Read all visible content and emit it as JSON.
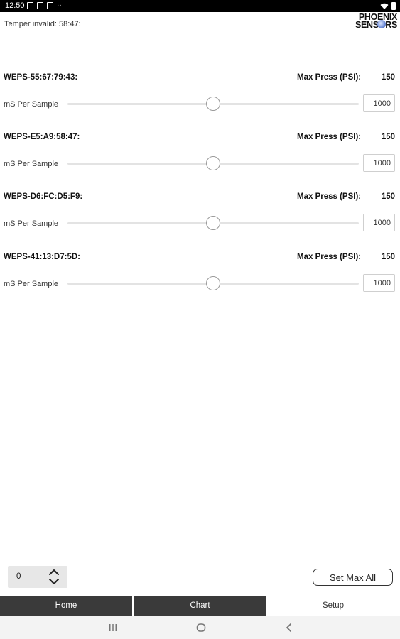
{
  "status_bar": {
    "time": "12:50",
    "left_icons": [
      "image-icon",
      "notification-icon",
      "play-icon",
      "more-dots"
    ],
    "right_icons": [
      "wifi-icon",
      "battery-icon"
    ]
  },
  "header": {
    "temper_text": "Temper invalid: 58:47:",
    "logo_line1": "PHOENIX",
    "logo_line2": "SENSORS"
  },
  "sensors": [
    {
      "id": "WEPS-55:67:79:43:",
      "max_label": "Max Press (PSI):",
      "max_value": "150",
      "sample_label": "mS Per Sample",
      "sample_value": "1000",
      "slider_fraction": 0.5
    },
    {
      "id": "WEPS-E5:A9:58:47:",
      "max_label": "Max Press (PSI):",
      "max_value": "150",
      "sample_label": "mS Per Sample",
      "sample_value": "1000",
      "slider_fraction": 0.5
    },
    {
      "id": "WEPS-D6:FC:D5:F9:",
      "max_label": "Max Press (PSI):",
      "max_value": "150",
      "sample_label": "mS Per Sample",
      "sample_value": "1000",
      "slider_fraction": 0.5
    },
    {
      "id": "WEPS-41:13:D7:5D:",
      "max_label": "Max Press (PSI):",
      "max_value": "150",
      "sample_label": "mS Per Sample",
      "sample_value": "1000",
      "slider_fraction": 0.5
    }
  ],
  "controls": {
    "stepper_value": "0",
    "set_max_all_label": "Set Max All"
  },
  "tabs": [
    {
      "label": "Home",
      "active": false
    },
    {
      "label": "Chart",
      "active": false
    },
    {
      "label": "Setup",
      "active": true
    }
  ],
  "nav_bar": {
    "icons": [
      "recents-icon",
      "home-icon",
      "back-icon"
    ]
  },
  "colors": {
    "tab_dark": "#3a3a3a",
    "status_bar": "#000000",
    "logo_accent": "#6d8ad6"
  }
}
